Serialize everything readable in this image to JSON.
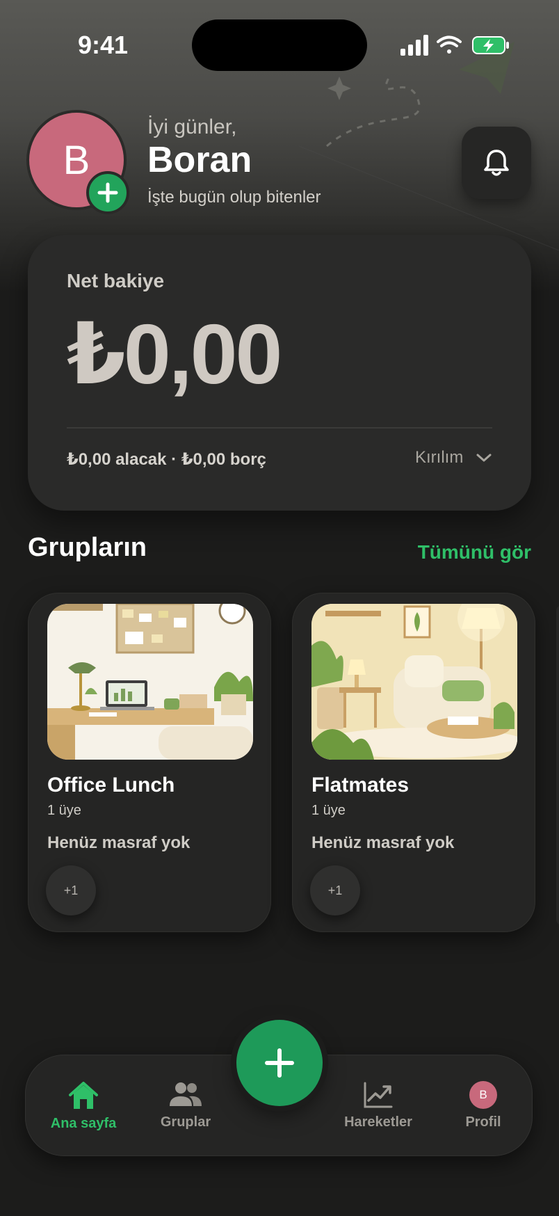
{
  "status_bar": {
    "time": "9:41"
  },
  "header": {
    "avatar_initial": "B",
    "greeting": "İyi günler,",
    "user_name": "Boran",
    "subtitle": "İşte bugün olup bitenler"
  },
  "balance": {
    "label": "Net bakiye",
    "amount": "₺0,00",
    "summary": "₺0,00 alacak · ₺0,00 borç",
    "breakdown_label": "Kırılım"
  },
  "groups_section": {
    "title": "Grupların",
    "see_all": "Tümünü gör",
    "groups": [
      {
        "name": "Office Lunch",
        "members": "1 üye",
        "status": "Henüz masraf yok",
        "member_chip": "+1"
      },
      {
        "name": "Flatmates",
        "members": "1 üye",
        "status": "Henüz masraf yok",
        "member_chip": "+1"
      }
    ]
  },
  "tabbar": {
    "tabs": [
      {
        "label": "Ana sayfa",
        "icon": "home-icon",
        "active": true
      },
      {
        "label": "Gruplar",
        "icon": "people-icon",
        "active": false
      },
      {
        "label": "Hareketler",
        "icon": "chart-icon",
        "active": false
      },
      {
        "label": "Profil",
        "icon": "avatar",
        "active": false
      }
    ],
    "profile_initial": "B"
  },
  "colors": {
    "accent": "#22a45b",
    "avatar": "#c8697c",
    "background": "#1c1c1b",
    "card": "#2a2a29"
  }
}
